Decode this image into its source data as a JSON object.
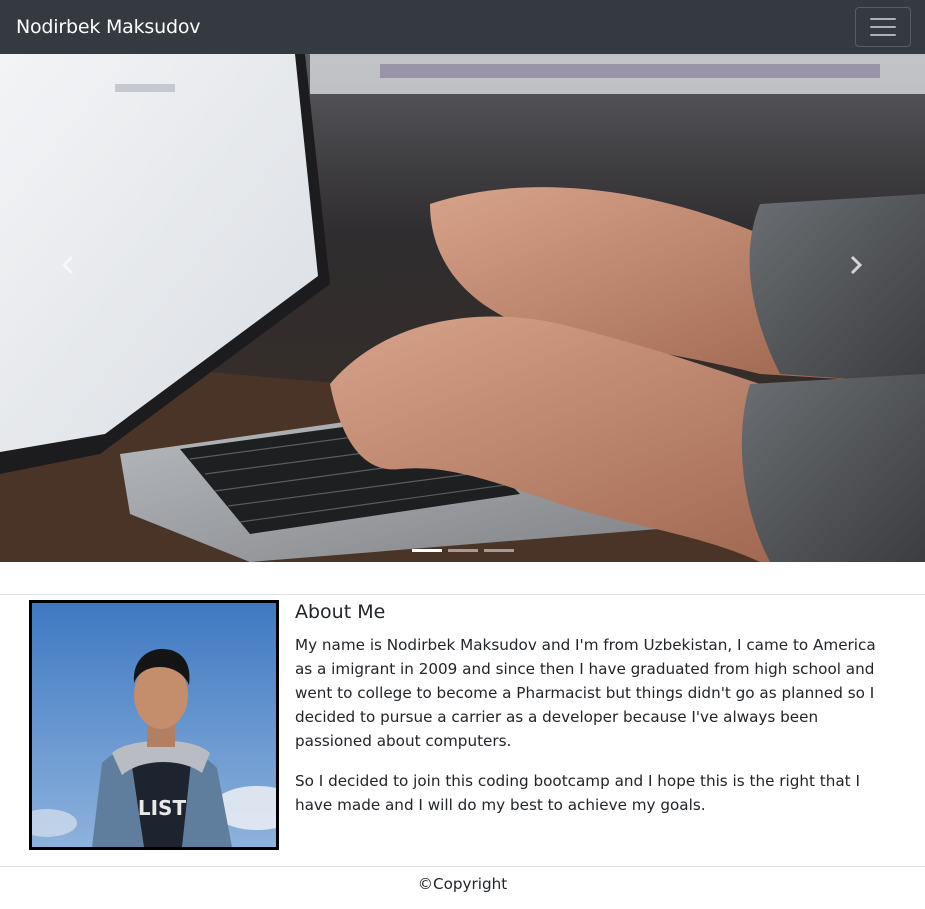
{
  "navbar": {
    "brand": "Nodirbek Maksudov",
    "toggler_icon": "hamburger-menu-icon"
  },
  "carousel": {
    "image_subject": "hands typing on laptop",
    "prev_icon": "chevron-left-icon",
    "next_icon": "chevron-right-icon",
    "slide_count": 3,
    "active_slide": 1
  },
  "about": {
    "heading": "About Me",
    "paragraphs": [
      "My name is Nodirbek Maksudov and I'm from Uzbekistan, I came to America as a imigrant in 2009 and since then I have graduated from high school and went to college to become a Pharmacist but things didn't go as planned so I decided to pursue a carrier as a developer because I've always been passioned about computers.",
      "So I decided to join this coding bootcamp and I hope this is the right that I have made and I will do my best to achieve my goals."
    ]
  },
  "footer": {
    "text": "©Copyright"
  }
}
